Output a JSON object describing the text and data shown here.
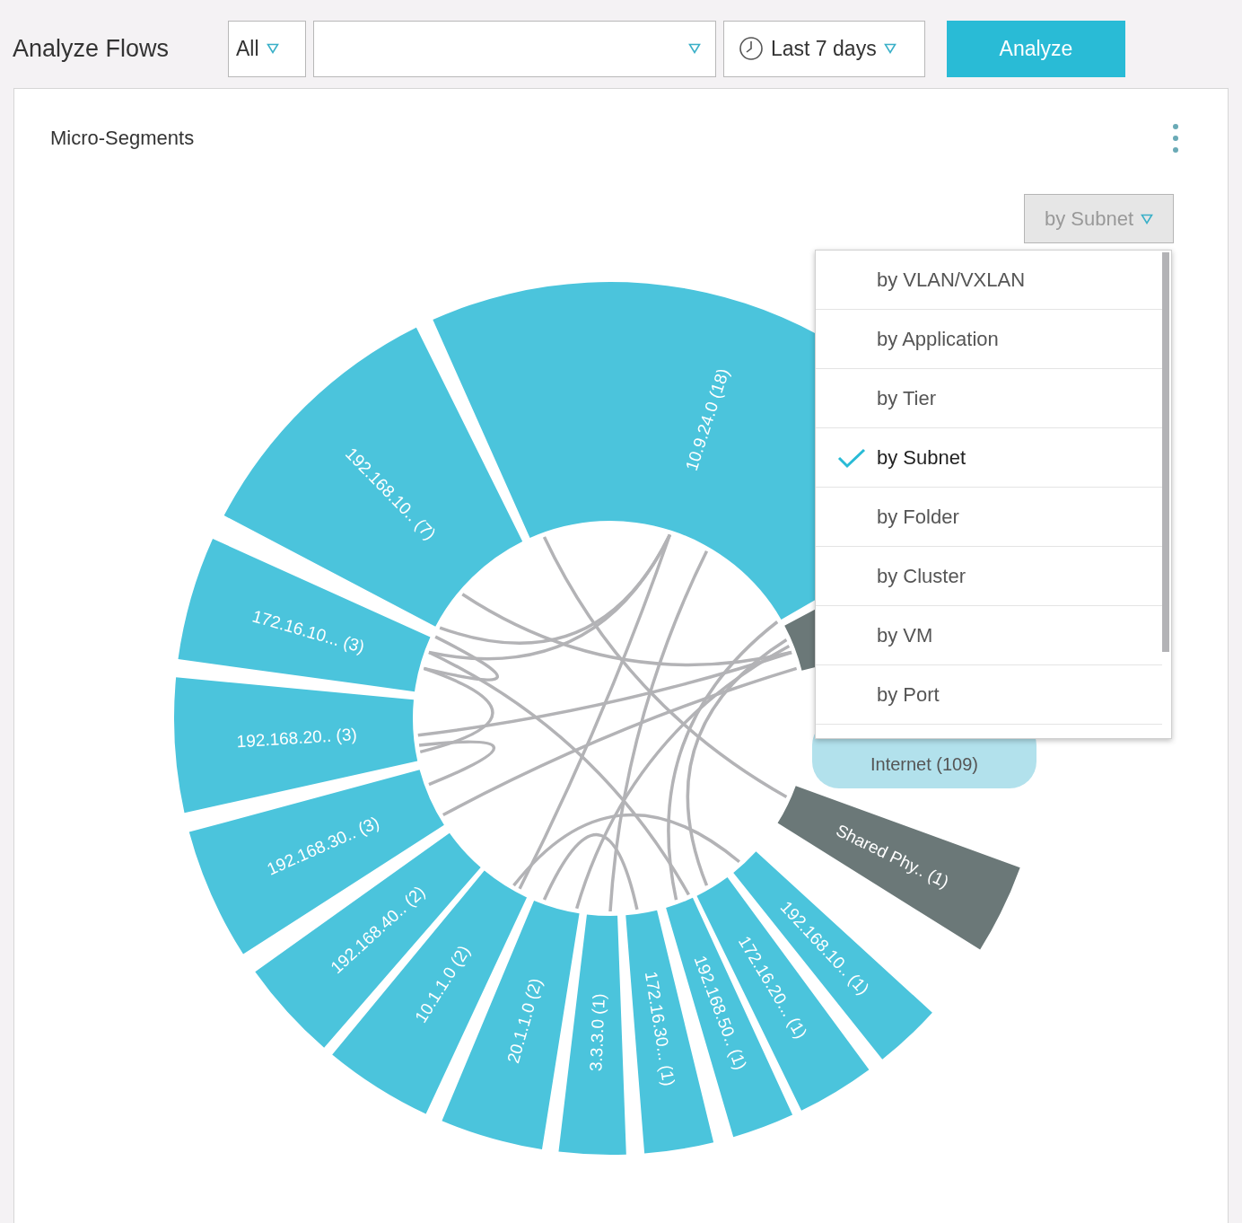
{
  "page_title": "Analyze Flows",
  "filters": {
    "scope": {
      "value": "All"
    },
    "time_range": {
      "value": "Last 7 days"
    },
    "analyze_button": "Analyze"
  },
  "card": {
    "title": "Micro-Segments",
    "group_by": {
      "value": "by Subnet",
      "menu_open": true
    },
    "menu_items": [
      {
        "label": "by VLAN/VXLAN",
        "selected": false
      },
      {
        "label": "by Application",
        "selected": false
      },
      {
        "label": "by Tier",
        "selected": false
      },
      {
        "label": "by Subnet",
        "selected": true
      },
      {
        "label": "by Folder",
        "selected": false
      },
      {
        "label": "by Cluster",
        "selected": false
      },
      {
        "label": "by VM",
        "selected": false
      },
      {
        "label": "by Port",
        "selected": false
      }
    ],
    "tooltip": "Internet (109)",
    "segments": [
      {
        "label": "10.9.24.0 (18)",
        "color": "#4bc4dc"
      },
      {
        "color": "#6b7878"
      },
      {
        "label": "Shared Phy.. (1)",
        "color": "#6b7878"
      },
      {
        "label": "192.168.10.. (1)",
        "color": "#4bc4dc"
      },
      {
        "label": "172.16.20... (1)",
        "color": "#4bc4dc"
      },
      {
        "label": "192.168.50.. (1)",
        "color": "#4bc4dc"
      },
      {
        "label": "172.16.30... (1)",
        "color": "#4bc4dc"
      },
      {
        "label": "3.3.3.0 (1)",
        "color": "#4bc4dc"
      },
      {
        "label": "20.1.1.0 (2)",
        "color": "#4bc4dc"
      },
      {
        "label": "10.1.1.0 (2)",
        "color": "#4bc4dc"
      },
      {
        "label": "192.168.40.. (2)",
        "color": "#4bc4dc"
      },
      {
        "label": "192.168.30.. (3)",
        "color": "#4bc4dc"
      },
      {
        "label": "192.168.20.. (3)",
        "color": "#4bc4dc"
      },
      {
        "label": "172.16.10... (3)",
        "color": "#4bc4dc"
      },
      {
        "label": "192.168.10.. (7)",
        "color": "#4bc4dc"
      }
    ]
  }
}
